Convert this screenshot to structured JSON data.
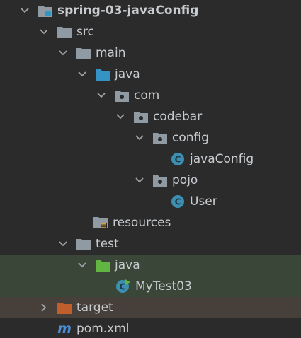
{
  "project": {
    "name": "spring-03-javaConfig"
  },
  "tree": {
    "src": "src",
    "main": "main",
    "main_java": "java",
    "com": "com",
    "codebar": "codebar",
    "config": "config",
    "javaConfig": "javaConfig",
    "pojo": "pojo",
    "user": "User",
    "resources": "resources",
    "test": "test",
    "test_java": "java",
    "mytest": "MyTest03",
    "target": "target",
    "pom": "pom.xml"
  },
  "icons": {
    "module": "module-folder-icon",
    "folder": "folder-icon",
    "source_root": "source-root-folder-icon",
    "package": "package-icon",
    "class": "java-class-icon",
    "resources": "resources-folder-icon",
    "test_root": "test-source-root-folder-icon",
    "test_class": "test-class-icon",
    "excluded": "excluded-folder-icon",
    "maven": "maven-icon"
  },
  "colors": {
    "background": "#2b2b2b",
    "text": "#c8ccd0",
    "folder_gray": "#8f9aa3",
    "source_blue": "#3592c4",
    "test_green": "#62b543",
    "excluded_orange": "#c05f2c",
    "class_teal": "#3c8fb0",
    "test_row_highlight": "#3a4638",
    "target_row_highlight": "#47403a"
  }
}
